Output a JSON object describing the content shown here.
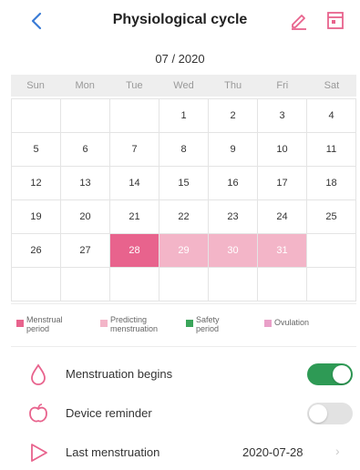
{
  "header": {
    "title": "Physiological cycle",
    "back_icon": "back-arrow-icon",
    "edit_icon": "pencil-icon",
    "calendar_icon": "calendar-icon",
    "accent": "#e8638d"
  },
  "month_label": "07 / 2020",
  "weekdays": [
    "Sun",
    "Mon",
    "Tue",
    "Wed",
    "Thu",
    "Fri",
    "Sat"
  ],
  "calendar": {
    "rows": [
      [
        {
          "d": ""
        },
        {
          "d": ""
        },
        {
          "d": ""
        },
        {
          "d": "1"
        },
        {
          "d": "2"
        },
        {
          "d": "3"
        },
        {
          "d": "4"
        }
      ],
      [
        {
          "d": "5"
        },
        {
          "d": "6"
        },
        {
          "d": "7"
        },
        {
          "d": "8"
        },
        {
          "d": "9"
        },
        {
          "d": "10"
        },
        {
          "d": "11"
        }
      ],
      [
        {
          "d": "12"
        },
        {
          "d": "13"
        },
        {
          "d": "14"
        },
        {
          "d": "15"
        },
        {
          "d": "16"
        },
        {
          "d": "17"
        },
        {
          "d": "18"
        }
      ],
      [
        {
          "d": "19"
        },
        {
          "d": "20"
        },
        {
          "d": "21"
        },
        {
          "d": "22"
        },
        {
          "d": "23"
        },
        {
          "d": "24"
        },
        {
          "d": "25"
        }
      ],
      [
        {
          "d": "26"
        },
        {
          "d": "27"
        },
        {
          "d": "28",
          "s": "menstrual"
        },
        {
          "d": "29",
          "s": "predict"
        },
        {
          "d": "30",
          "s": "predict"
        },
        {
          "d": "31",
          "s": "predict"
        },
        {
          "d": ""
        }
      ],
      [
        {
          "d": ""
        },
        {
          "d": ""
        },
        {
          "d": ""
        },
        {
          "d": ""
        },
        {
          "d": ""
        },
        {
          "d": ""
        },
        {
          "d": ""
        }
      ]
    ]
  },
  "legend": {
    "menstrual": {
      "label": "Menstrual period",
      "color": "#e8638d"
    },
    "predicting": {
      "label": "Predicting menstruation",
      "color": "#f3b5c8"
    },
    "safety": {
      "label": "Safety period",
      "color": "#3aa55a"
    },
    "ovulation": {
      "label": "Ovulation",
      "color": "#e9a0c8"
    }
  },
  "settings": {
    "menstruation_begins": {
      "label": "Menstruation begins",
      "on": true,
      "icon": "drop-icon"
    },
    "device_reminder": {
      "label": "Device reminder",
      "on": false,
      "icon": "apple-icon"
    },
    "last_menstruation": {
      "label": "Last menstruation",
      "value": "2020-07-28",
      "icon": "play-triangle-icon"
    }
  }
}
